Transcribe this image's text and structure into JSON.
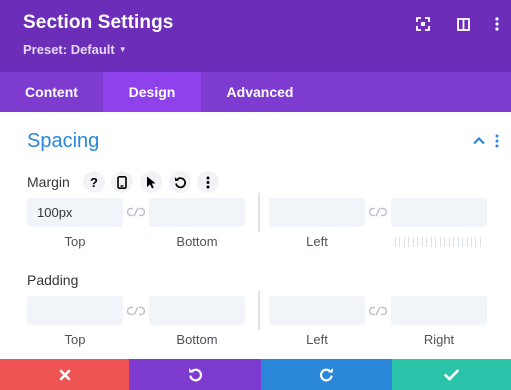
{
  "header": {
    "title": "Section Settings",
    "preset": "Preset: Default",
    "icons": [
      "expand-icon",
      "sidebar-layout-icon",
      "more-vertical-icon"
    ]
  },
  "tabs": [
    {
      "label": "Content",
      "active": false
    },
    {
      "label": "Design",
      "active": true
    },
    {
      "label": "Advanced",
      "active": false
    }
  ],
  "section": {
    "title": "Spacing",
    "icons": [
      "chevron-up-icon",
      "more-vertical-icon"
    ]
  },
  "margin": {
    "label": "Margin",
    "tools": [
      "help-icon",
      "mobile-icon",
      "cursor-icon",
      "undo-icon",
      "more-vertical-icon"
    ],
    "fields": [
      {
        "caption": "Top",
        "value": "100px"
      },
      {
        "caption": "Bottom",
        "value": ""
      },
      {
        "caption": "Left",
        "value": ""
      },
      {
        "caption": "Right",
        "value": ""
      }
    ]
  },
  "padding": {
    "label": "Padding",
    "fields": [
      {
        "caption": "Top",
        "value": ""
      },
      {
        "caption": "Bottom",
        "value": ""
      },
      {
        "caption": "Left",
        "value": ""
      },
      {
        "caption": "Right",
        "value": ""
      }
    ]
  },
  "footer": {
    "buttons": [
      "close-icon",
      "undo-icon",
      "redo-icon",
      "check-icon"
    ]
  },
  "colors": {
    "header": "#6c2eb9",
    "tabs": "#7e3bd0",
    "tab_active": "#8f42ec",
    "accent": "#2b87da",
    "cancel": "#ef5555",
    "save": "#29c4a9"
  }
}
